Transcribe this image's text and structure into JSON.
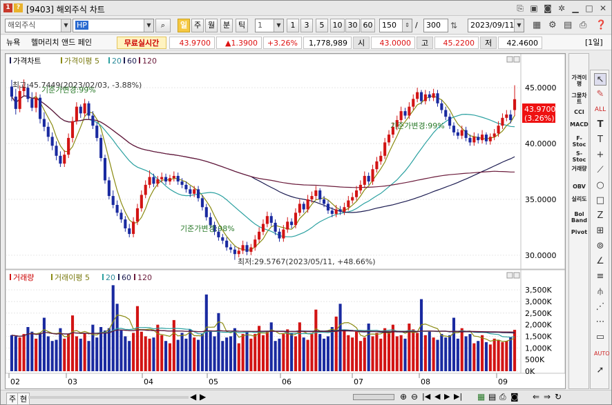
{
  "window": {
    "app_code": "1",
    "help": "?",
    "title": "[9403] 해외주식 차트"
  },
  "title_icons": [
    "link-icon",
    "image-icon",
    "camera-icon",
    "gear-icon",
    "minimize-icon",
    "maximize-icon",
    "close-icon"
  ],
  "toolbar": {
    "market_select": "해외주식",
    "symbol_input": "HP",
    "periods": [
      "일",
      "주",
      "월",
      "분",
      "틱"
    ],
    "active_period": "일",
    "period_unit": "1",
    "intervals": [
      "1",
      "3",
      "5",
      "10",
      "30",
      "60"
    ],
    "count": "150",
    "separator": "/",
    "total": "300",
    "date": "2023/09/11"
  },
  "quote": {
    "exchange": "뉴욕",
    "name": "헬머리치 앤드 페인",
    "realtime_label": "무료실시간",
    "price": "43.9700",
    "change": "▲1.3900",
    "change_pct": "+3.26%",
    "volume": "1,778,989",
    "open_label": "시",
    "open": "43.0000",
    "high_label": "고",
    "high": "45.2200",
    "low_label": "저",
    "low": "42.4600",
    "period_tag": "[1일]"
  },
  "colors": {
    "up": "#d21414",
    "down": "#1a2aa0",
    "ma5": "#8a8a10",
    "ma20": "#2aa0a0",
    "ma60": "#1a1a50",
    "ma120": "#6a1a3a",
    "current": "#e11"
  },
  "chart_data": [
    {
      "type": "candlestick",
      "legend": [
        "가격차트",
        "가격이평 5",
        "20",
        "60",
        "120"
      ],
      "ylim": [
        29.0,
        46.8
      ],
      "yticks": [
        "45.0000",
        "40.0000",
        "35.0000",
        "30.0000"
      ],
      "ytick_values": [
        45,
        40,
        35,
        30
      ],
      "current_price": "43.9700",
      "current_pct": "(3.26%)",
      "annotations": {
        "high": "최고:45.7449(2023/02/03, -3.88%)",
        "low": "최저:29.5767(2023/05/11, +48.66%)",
        "base1": "기준가변경:99%",
        "base2": "기준가변경:98%",
        "base3": "기준가변경:99%"
      },
      "months": [
        "02",
        "03",
        "04",
        "05",
        "06",
        "07",
        "08",
        "09"
      ],
      "close": [
        44.2,
        43.1,
        44.7,
        45.1,
        44.0,
        43.2,
        44.1,
        42.2,
        41.5,
        40.6,
        39.8,
        38.9,
        38.2,
        39.0,
        40.5,
        42.0,
        43.3,
        42.7,
        43.6,
        42.5,
        41.6,
        40.5,
        38.7,
        36.7,
        35.3,
        34.5,
        33.8,
        33.2,
        32.4,
        31.9,
        33.0,
        34.2,
        35.4,
        36.3,
        37.0,
        36.4,
        36.8,
        37.0,
        36.6,
        36.9,
        37.1,
        36.6,
        36.3,
        35.9,
        35.5,
        35.9,
        35.1,
        34.3,
        33.4,
        32.7,
        32.1,
        31.6,
        31.3,
        30.7,
        30.5,
        30.1,
        30.4,
        30.9,
        30.3,
        30.7,
        31.4,
        32.1,
        32.8,
        33.5,
        32.9,
        32.1,
        31.5,
        32.3,
        33.0,
        32.7,
        33.8,
        34.6,
        34.1,
        35.0,
        35.3,
        35.8,
        35.0,
        34.6,
        34.0,
        33.7,
        34.1,
        33.9,
        34.3,
        34.9,
        35.2,
        35.8,
        36.3,
        37.1,
        36.6,
        37.7,
        38.4,
        38.9,
        40.1,
        40.8,
        41.5,
        42.1,
        42.9,
        42.5,
        43.3,
        44.0,
        44.6,
        43.8,
        44.4,
        44.1,
        44.5,
        43.6,
        43.0,
        42.4,
        41.6,
        41.0,
        40.7,
        41.2,
        40.5,
        40.1,
        40.6,
        40.3,
        40.8,
        40.2,
        40.6,
        40.9,
        41.6,
        42.3,
        42.6,
        42.1,
        43.97
      ],
      "open": [
        45.1,
        44.2,
        43.1,
        44.7,
        45.0,
        44.0,
        43.2,
        44.1,
        42.2,
        41.5,
        40.6,
        39.8,
        38.9,
        38.2,
        39.0,
        40.5,
        42.0,
        43.3,
        42.7,
        43.6,
        42.5,
        41.6,
        40.5,
        38.7,
        36.7,
        35.3,
        34.5,
        33.8,
        33.2,
        32.4,
        31.9,
        33.0,
        34.2,
        35.4,
        36.3,
        37.0,
        36.4,
        36.8,
        37.0,
        36.6,
        36.9,
        37.1,
        36.6,
        36.3,
        35.9,
        35.5,
        35.9,
        35.1,
        34.3,
        33.4,
        32.7,
        32.1,
        31.6,
        31.3,
        30.7,
        30.5,
        30.1,
        30.4,
        30.9,
        30.3,
        30.7,
        31.4,
        32.1,
        32.8,
        33.5,
        32.9,
        32.1,
        31.5,
        32.3,
        33.0,
        32.7,
        33.8,
        34.6,
        34.1,
        35.0,
        35.3,
        35.8,
        35.0,
        34.6,
        34.0,
        33.7,
        34.1,
        33.9,
        34.3,
        34.9,
        35.2,
        35.8,
        36.3,
        37.1,
        36.6,
        37.7,
        38.4,
        38.9,
        40.1,
        40.8,
        41.5,
        42.1,
        42.9,
        42.5,
        43.3,
        44.0,
        44.6,
        43.8,
        44.4,
        44.1,
        44.5,
        43.6,
        43.0,
        42.4,
        41.6,
        41.0,
        40.7,
        41.2,
        40.5,
        40.1,
        40.6,
        40.3,
        40.8,
        40.2,
        40.6,
        40.9,
        41.6,
        42.3,
        42.6,
        43.0
      ],
      "high": [
        45.7,
        44.9,
        45.2,
        45.74,
        45.3,
        44.6,
        44.6,
        44.4,
        42.8,
        41.9,
        41.0,
        40.2,
        39.3,
        39.4,
        40.9,
        42.4,
        43.7,
        43.5,
        44.0,
        43.8,
        42.9,
        41.9,
        40.8,
        39.0,
        37.0,
        35.8,
        34.9,
        34.1,
        33.5,
        32.8,
        33.4,
        34.6,
        35.8,
        36.7,
        37.6,
        37.3,
        37.1,
        37.4,
        37.3,
        37.2,
        37.5,
        37.4,
        36.9,
        36.6,
        36.2,
        36.2,
        36.2,
        35.4,
        34.6,
        33.8,
        33.0,
        32.4,
        31.9,
        31.6,
        31.0,
        30.8,
        30.7,
        31.3,
        31.2,
        31.0,
        31.8,
        32.5,
        33.2,
        33.9,
        33.8,
        33.2,
        32.4,
        32.7,
        33.4,
        33.3,
        34.2,
        35.0,
        34.8,
        35.4,
        35.7,
        36.2,
        36.0,
        35.3,
        34.9,
        34.3,
        34.5,
        34.4,
        34.7,
        35.3,
        35.6,
        36.2,
        36.7,
        37.5,
        37.4,
        38.1,
        38.8,
        39.3,
        40.5,
        41.2,
        41.9,
        42.5,
        43.3,
        43.2,
        43.7,
        44.4,
        45.0,
        44.8,
        44.8,
        44.7,
        44.9,
        44.8,
        43.9,
        43.3,
        42.7,
        41.9,
        41.3,
        41.6,
        41.5,
        40.8,
        41.0,
        40.9,
        41.2,
        41.0,
        40.9,
        41.3,
        42.0,
        42.7,
        43.0,
        43.0,
        45.22
      ],
      "low": [
        43.8,
        42.6,
        42.8,
        44.3,
        43.7,
        42.9,
        42.8,
        41.8,
        41.1,
        40.2,
        39.4,
        38.5,
        37.9,
        37.9,
        38.7,
        40.1,
        41.7,
        42.3,
        42.4,
        42.2,
        41.3,
        40.2,
        38.4,
        36.4,
        35.0,
        34.2,
        33.5,
        32.9,
        32.1,
        31.6,
        31.6,
        32.7,
        33.9,
        35.1,
        36.0,
        36.1,
        36.1,
        36.5,
        36.3,
        36.3,
        36.6,
        36.3,
        36.0,
        35.6,
        35.2,
        35.2,
        34.8,
        34.0,
        33.1,
        32.4,
        31.8,
        31.3,
        31.0,
        30.4,
        30.2,
        29.58,
        29.8,
        30.1,
        30.0,
        30.0,
        30.4,
        31.1,
        31.8,
        32.5,
        32.6,
        31.8,
        31.2,
        31.2,
        32.0,
        32.4,
        32.4,
        33.5,
        33.8,
        33.8,
        34.7,
        35.0,
        34.7,
        34.3,
        33.7,
        33.4,
        33.4,
        33.6,
        33.6,
        34.0,
        34.6,
        34.9,
        35.5,
        36.0,
        36.3,
        36.3,
        37.4,
        38.1,
        38.6,
        39.8,
        40.5,
        41.2,
        41.8,
        42.2,
        42.2,
        43.0,
        43.7,
        43.5,
        43.5,
        43.8,
        43.8,
        43.3,
        42.7,
        42.1,
        41.3,
        40.7,
        40.4,
        40.4,
        40.2,
        39.8,
        39.8,
        40.0,
        40.0,
        39.9,
        39.9,
        40.3,
        40.6,
        41.3,
        42.0,
        41.8,
        42.46
      ]
    },
    {
      "type": "bar",
      "legend": [
        "거래량",
        "거래이평 5",
        "20",
        "60",
        "120"
      ],
      "ylim": [
        0,
        3800
      ],
      "yticks": [
        "3,500K",
        "3,000K",
        "2,500K",
        "2,000K",
        "1,500K",
        "1,000K",
        "500K",
        "0K"
      ],
      "ytick_values": [
        3500,
        3000,
        2500,
        2000,
        1500,
        1000,
        500,
        0
      ],
      "values": [
        1550,
        1500,
        1450,
        1600,
        1900,
        1700,
        1400,
        1650,
        2300,
        1500,
        1300,
        1350,
        1850,
        1400,
        1600,
        2400,
        1500,
        1400,
        1650,
        1300,
        2000,
        1450,
        1900,
        1750,
        1850,
        3700,
        2900,
        1750,
        1500,
        1300,
        1650,
        2800,
        1700,
        1500,
        1400,
        1450,
        2000,
        1550,
        1300,
        1200,
        2200,
        1350,
        1650,
        1400,
        1800,
        1450,
        1350,
        1600,
        3300,
        1750,
        1500,
        2500,
        1300,
        1450,
        1500,
        1850,
        1200,
        1600,
        1700,
        1400,
        1600,
        1950,
        1550,
        1700,
        2100,
        1300,
        1400,
        1600,
        1800,
        1650,
        1500,
        2100,
        1450,
        1350,
        1600,
        2650,
        1600,
        1400,
        1500,
        1900,
        2350,
        2900,
        1750,
        1550,
        1450,
        1700,
        1300,
        1450,
        2050,
        1500,
        1650,
        1400,
        1850,
        1700,
        2000,
        1500,
        1550,
        1400,
        2050,
        1800,
        1650,
        3100,
        1550,
        1700,
        1450,
        1350,
        1600,
        1450,
        1550,
        2300,
        1400,
        1850,
        1500,
        1600,
        1200,
        1300,
        1550,
        1250,
        1150,
        1400,
        1350,
        1250,
        1300,
        1450,
        1779
      ]
    }
  ],
  "right_bar": [
    "가격이평",
    "그물차트",
    "CCI",
    "MACD",
    "F-Stoc",
    "S-Stoc",
    "거래량",
    "OBV",
    "실리도",
    "Bol Band",
    "Pivot"
  ],
  "draw_tools": [
    "cursor-icon",
    "eraser-icon",
    "all-clear-icon",
    "text-icon",
    "text-icon-2",
    "cross-icon",
    "trend-icon",
    "circle-icon",
    "rectangle-icon",
    "zigzag-icon",
    "gann-icon",
    "cycle-icon",
    "angle-icon",
    "fibo-icon",
    "fork-icon",
    "fan-icon",
    "speed-icon",
    "channel-icon",
    "auto-icon",
    "arrow-icon"
  ],
  "bottom": {
    "label1": "주",
    "label2": "현"
  }
}
